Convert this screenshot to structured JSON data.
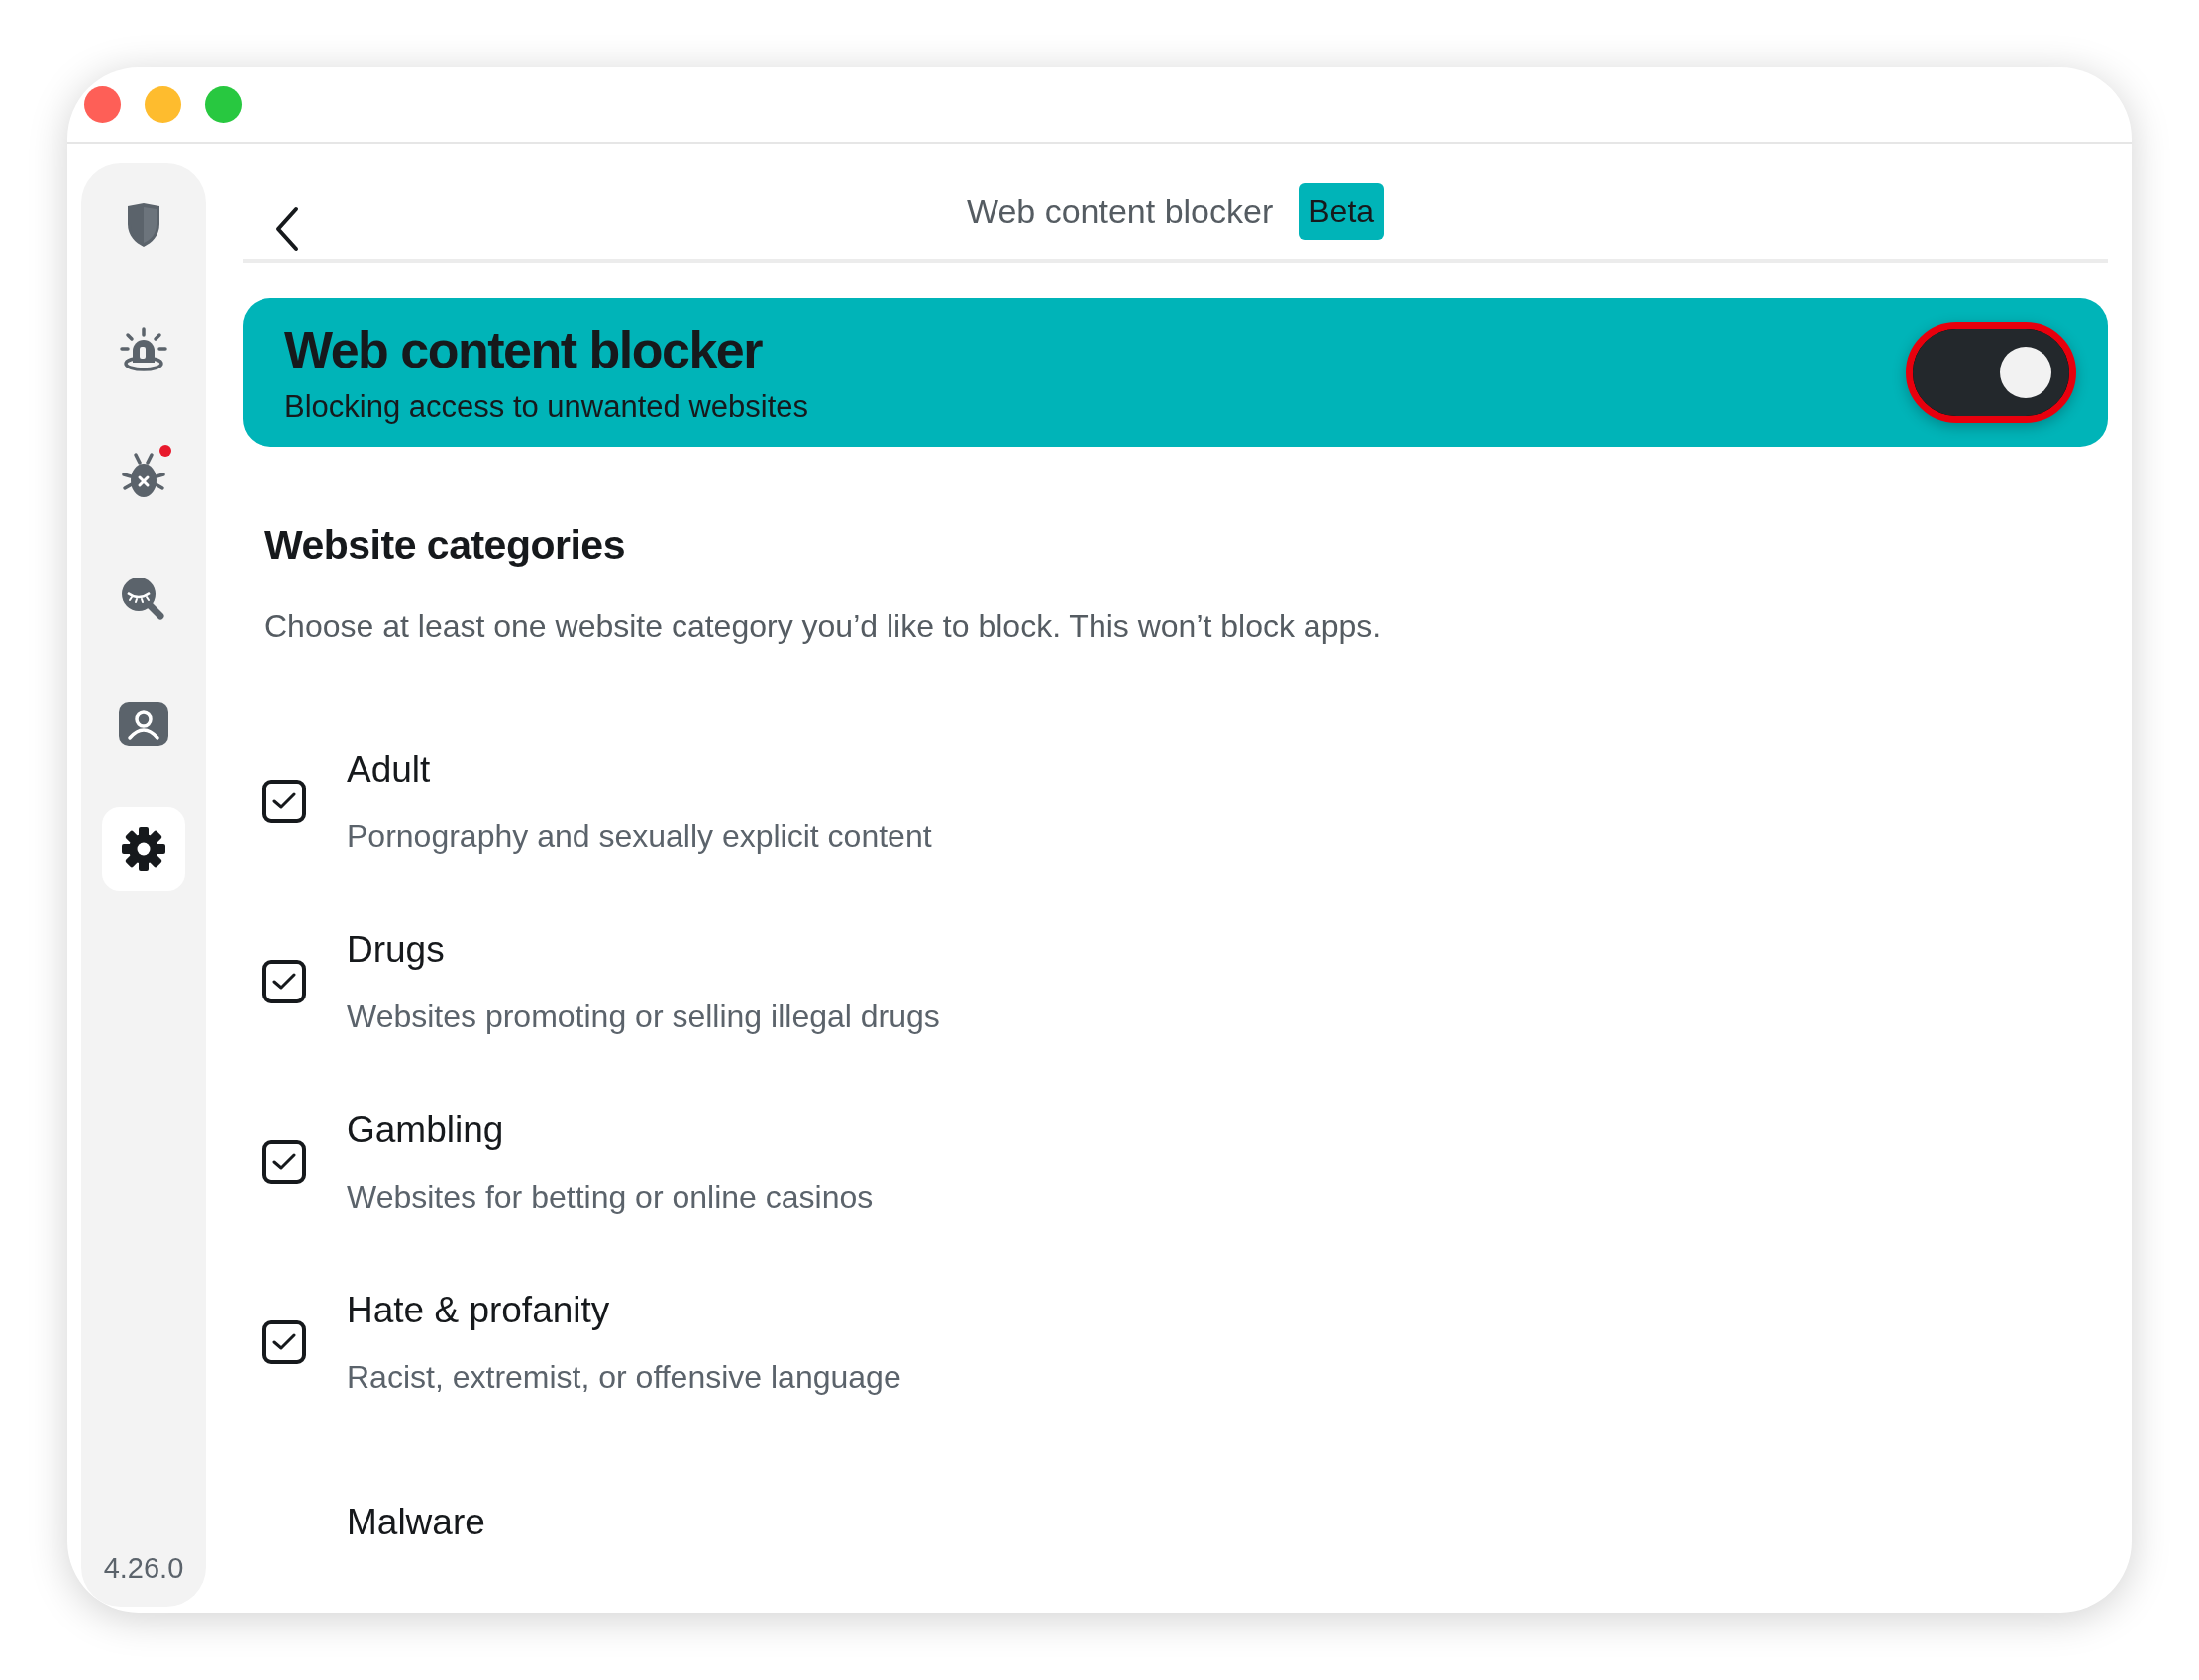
{
  "sidebar": {
    "items": [
      {
        "selected": false,
        "notification": false
      },
      {
        "selected": false,
        "notification": false
      },
      {
        "selected": false,
        "notification": true
      },
      {
        "selected": false,
        "notification": false
      },
      {
        "selected": false,
        "notification": false
      },
      {
        "selected": true,
        "notification": false
      }
    ],
    "version": "4.26.0"
  },
  "header": {
    "title": "Web content blocker",
    "badge": "Beta"
  },
  "banner": {
    "title": "Web content blocker",
    "subtitle": "Blocking access to unwanted websites",
    "on": true
  },
  "section": {
    "title": "Website categories",
    "description": "Choose at least one website category you’d like to block. This won’t block apps."
  },
  "categories": [
    {
      "name": "Adult",
      "description": "Pornography and sexually explicit content",
      "checked": true
    },
    {
      "name": "Drugs",
      "description": "Websites promoting or selling illegal drugs",
      "checked": true
    },
    {
      "name": "Gambling",
      "description": "Websites for betting or online casinos",
      "checked": true
    },
    {
      "name": "Hate & profanity",
      "description": "Racist, extremist, or offensive language",
      "checked": true
    },
    {
      "name": "Malware"
    }
  ]
}
